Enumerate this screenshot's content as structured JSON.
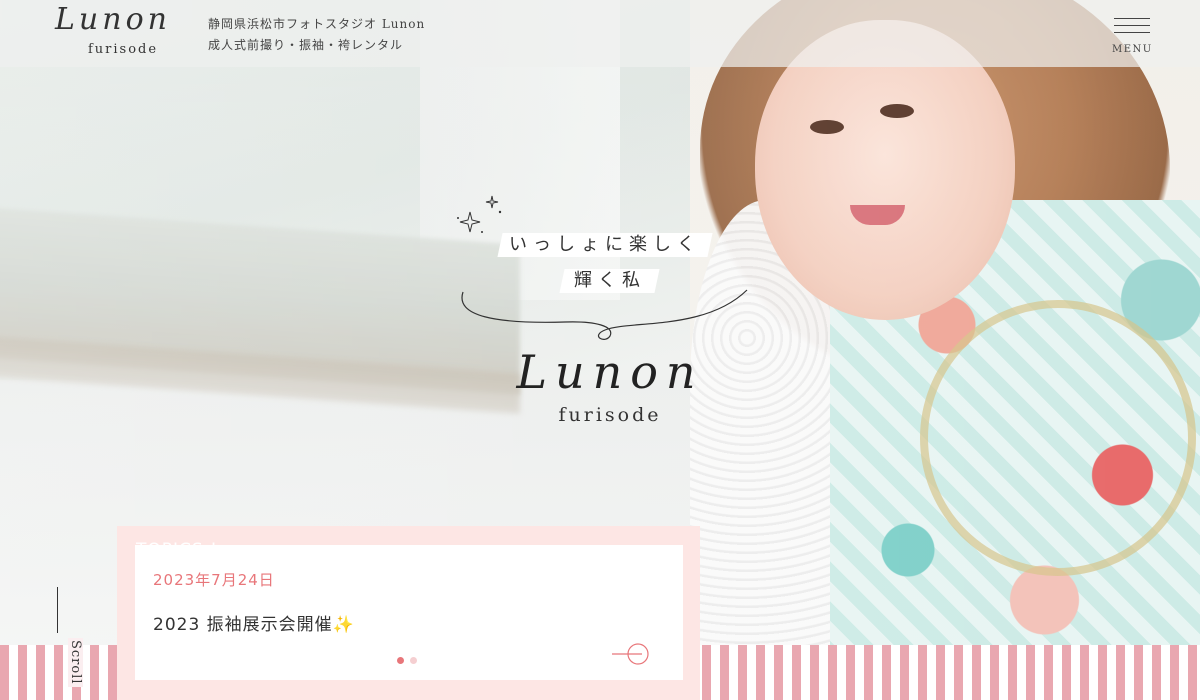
{
  "header": {
    "logo_script": "Lunon",
    "logo_sub": "furisode",
    "tagline_line1": "静岡県浜松市フォトスタジオ Lunon",
    "tagline_line2": "成人式前撮り・振袖・袴レンタル",
    "menu_label": "MENU"
  },
  "hero": {
    "copy_line1": "いっしょに楽しく",
    "copy_line2": "輝く私",
    "center_logo_script": "Lunon",
    "center_logo_sub": "furisode"
  },
  "scroll": {
    "label": "Scroll"
  },
  "topics": {
    "heading": "TOPICS !",
    "items": [
      {
        "date": "2023年7月24日",
        "title": "2023 振袖展示会開催",
        "emoji": "✨"
      }
    ],
    "pagination_active": 1,
    "pagination_total": 2
  },
  "colors": {
    "accent_pink": "#e8767a",
    "card_bg": "#fde6e4",
    "stripe_pink": "#e9a7b0"
  }
}
